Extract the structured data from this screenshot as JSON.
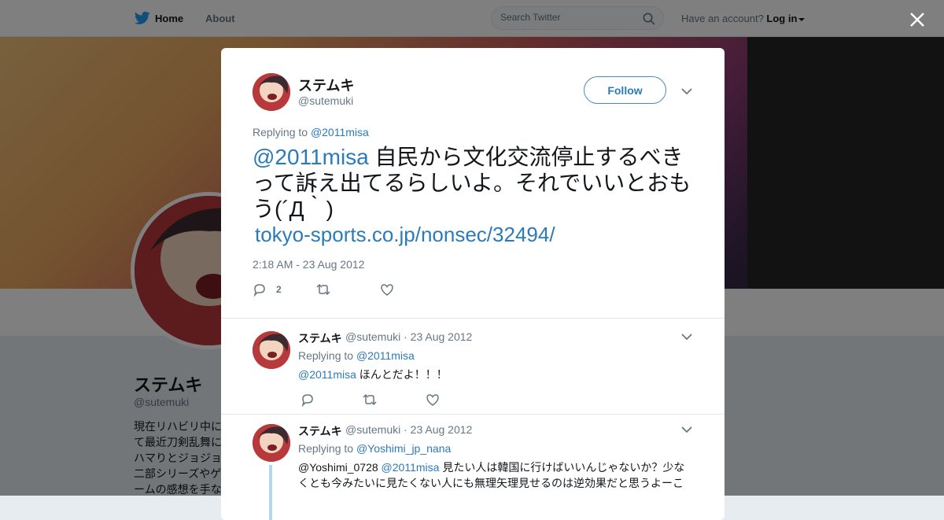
{
  "nav": {
    "home_label": "Home",
    "about_label": "About",
    "search_placeholder": "Search Twitter",
    "have_account": "Have an account?",
    "login_label": "Log in"
  },
  "profile": {
    "name": "ステムキ",
    "handle": "@sutemuki",
    "bio": "現在リハビリ中にて最近刀剣乱舞にハマりとジョジョ二部シリーズやゲームの感想を手な方はご注意く"
  },
  "tweet": {
    "author_name": "ステムキ",
    "author_handle": "@sutemuki",
    "follow_label": "Follow",
    "replying_prefix": "Replying to",
    "replying_to": "@2011misa",
    "mention": "@2011misa",
    "text": " 自民から文化交流停止するべきって訴え出てるらしいよ。それでいいとおもう(´Д｀)",
    "url": "tokyo-sports.co.jp/nonsec/32494/",
    "timestamp": "2:18 AM - 23 Aug 2012",
    "reply_count": "2"
  },
  "replies": [
    {
      "name": "ステムキ",
      "handle": "@sutemuki",
      "date": "· 23 Aug 2012",
      "replying_prefix": "Replying to",
      "replying_to": "@2011misa",
      "mention": "@2011misa",
      "text": " ほんとだよ！！！"
    },
    {
      "name": "ステムキ",
      "handle": "@sutemuki",
      "date": "· 23 Aug 2012",
      "replying_prefix": "Replying to",
      "replying_to": "@Yoshimi_jp_nana",
      "prefix_text": "@Yoshimi_0728 ",
      "mention": "@2011misa",
      "text": " 見たい人は韓国に行けばいいんじゃないか？少なくとも今みたいに見たくない人にも無理矢理見せるのは逆効果だと思うよーこ"
    }
  ],
  "colors": {
    "link": "#2b7bb9",
    "twitter_blue": "#1da1f2",
    "muted": "#657786"
  },
  "icons": [
    "twitter-bird-icon",
    "search-icon",
    "close-icon",
    "chevron-down-icon",
    "reply-icon",
    "retweet-icon",
    "like-icon"
  ]
}
